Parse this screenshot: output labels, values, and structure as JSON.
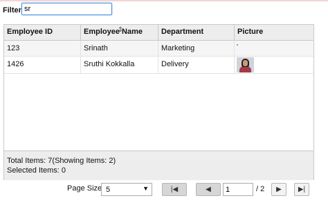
{
  "filter": {
    "label": "Filter:",
    "value": "sr"
  },
  "grid": {
    "columns": [
      "Employee ID",
      "Employee Name",
      "Department",
      "Picture"
    ],
    "rows": [
      {
        "id": "123",
        "name": "Srinath",
        "department": "Marketing"
      },
      {
        "id": "1426",
        "name": "Sruthi Kokkalla",
        "department": "Delivery"
      }
    ],
    "footer": {
      "total": "Total Items: 7(Showing Items: 2)",
      "selected": "Selected Items: 0"
    }
  },
  "pager": {
    "page_size_label": "Page Size:",
    "page_size_value": "5",
    "current_page": "1",
    "total_pages": "/ 2",
    "icons": {
      "first": "first-page-icon",
      "prev": "prev-page-icon",
      "next": "next-page-icon",
      "last": "last-page-icon"
    }
  },
  "colors": {
    "accent": "#4a90d9",
    "header_bg": "#ededed",
    "border": "#c8c8c8"
  }
}
